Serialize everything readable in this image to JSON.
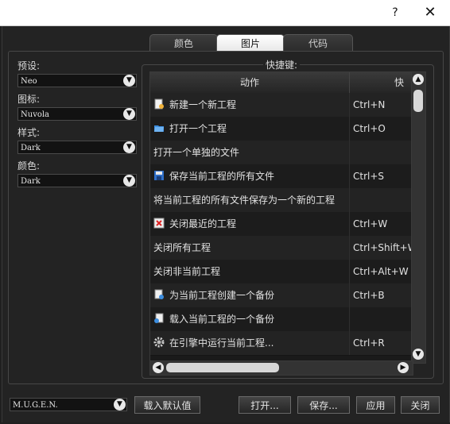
{
  "titlebar": {
    "help": "?",
    "close": "✕"
  },
  "tabs": [
    {
      "label": "颜色",
      "active": false
    },
    {
      "label": "图片",
      "active": true
    },
    {
      "label": "代码",
      "active": false
    }
  ],
  "left": {
    "preset_label": "预设:",
    "preset_value": "Neo",
    "icons_label": "图标:",
    "icons_value": "Nuvola",
    "style_label": "样式:",
    "style_value": "Dark",
    "color_label": "颜色:",
    "color_value": "Dark"
  },
  "shortcuts": {
    "title": "快捷键:",
    "col_action": "动作",
    "col_key": "快捷",
    "rows": [
      {
        "action": "新建一个新工程",
        "key": "Ctrl+N",
        "icon": "new-project-icon"
      },
      {
        "action": "打开一个工程",
        "key": "Ctrl+O",
        "icon": "open-folder-icon"
      },
      {
        "action": "打开一个单独的文件",
        "key": "",
        "icon": ""
      },
      {
        "action": "保存当前工程的所有文件",
        "key": "Ctrl+S",
        "icon": "save-icon"
      },
      {
        "action": "将当前工程的所有文件保存为一个新的工程",
        "key": "",
        "icon": ""
      },
      {
        "action": "关闭最近的工程",
        "key": "Ctrl+W",
        "icon": "close-project-icon"
      },
      {
        "action": "关闭所有工程",
        "key": "Ctrl+Shift+W",
        "icon": ""
      },
      {
        "action": "关闭非当前工程",
        "key": "Ctrl+Alt+W",
        "icon": ""
      },
      {
        "action": "为当前工程创建一个备份",
        "key": "Ctrl+B",
        "icon": "backup-icon"
      },
      {
        "action": "载入当前工程的一个备份",
        "key": "",
        "icon": "restore-backup-icon"
      },
      {
        "action": "在引擎中运行当前工程...",
        "key": "Ctrl+R",
        "icon": "gear-icon"
      }
    ]
  },
  "bottom": {
    "engine_value": "M.U.G.E.N.",
    "load_defaults": "载入默认值",
    "open": "打开...",
    "save": "保存...",
    "apply": "应用",
    "close": "关闭"
  },
  "colors": {
    "accent": "#2f7fd0",
    "background": "#1f1f1f"
  }
}
